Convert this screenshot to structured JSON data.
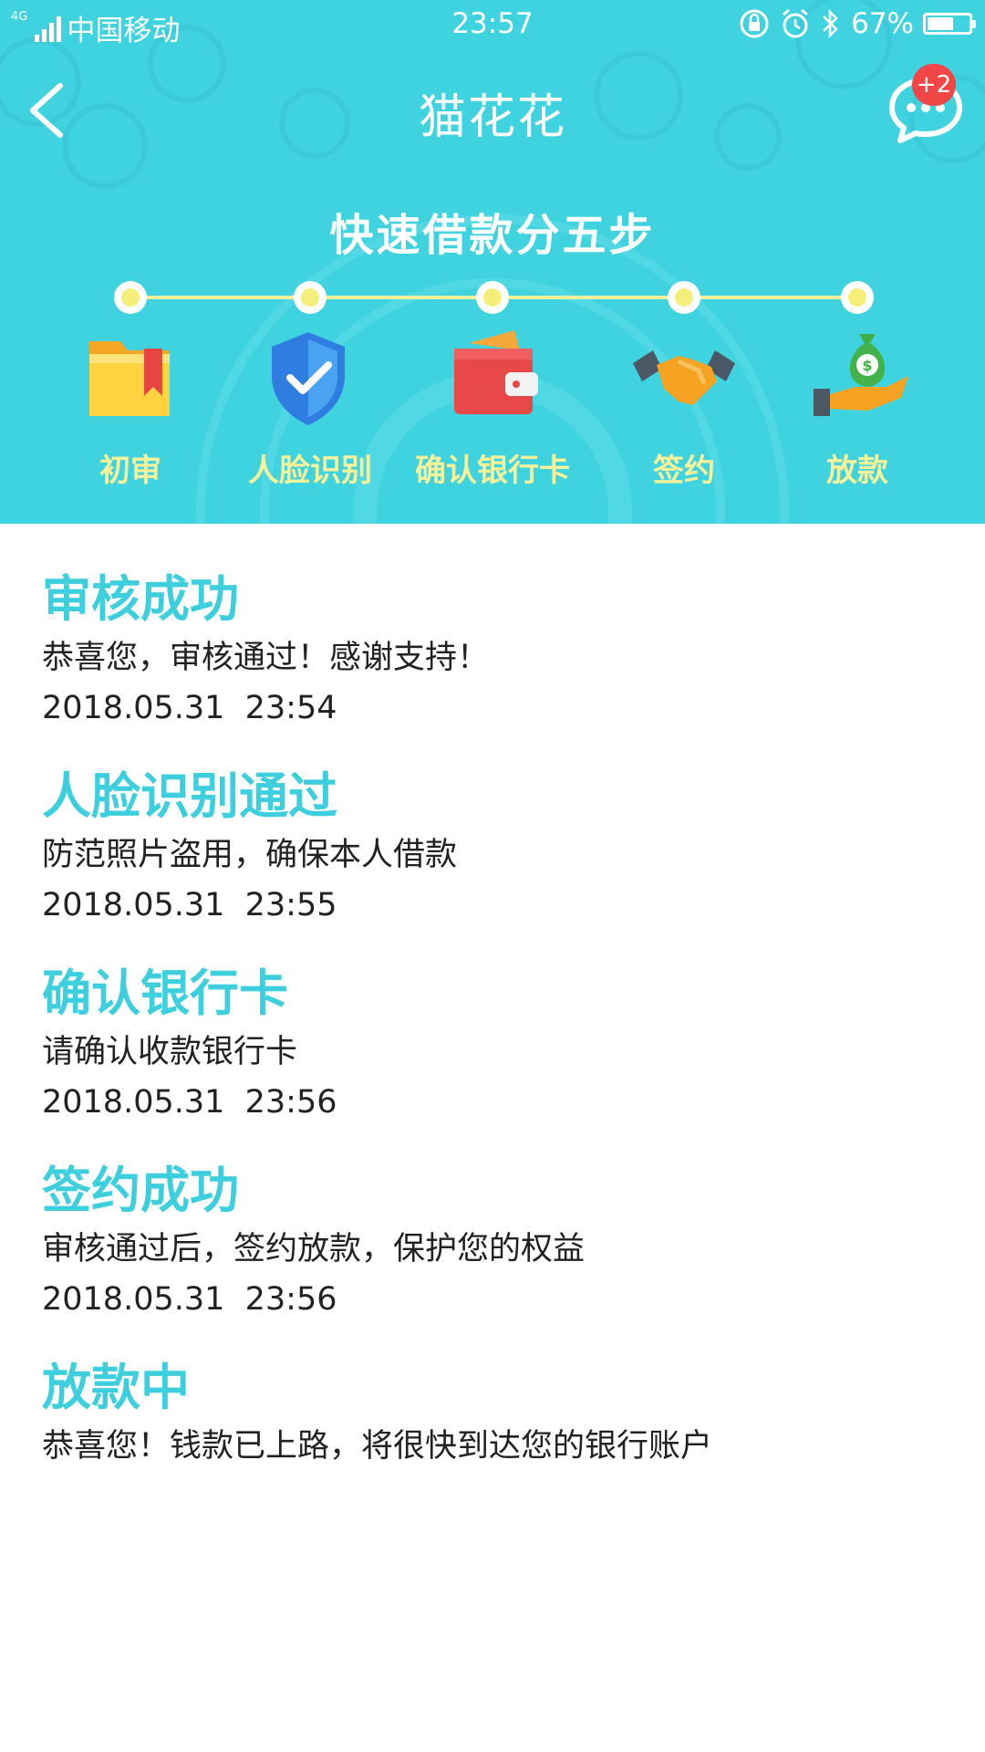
{
  "status_bar": {
    "network": "4G",
    "carrier": "中国移动",
    "time": "23:57",
    "battery_percent": "67%",
    "battery_level": 0.67
  },
  "nav": {
    "title": "猫花花",
    "badge_count": "+2"
  },
  "hero": {
    "heading": "快速借款分五步",
    "steps": [
      {
        "label": "初审",
        "icon": "folder-icon"
      },
      {
        "label": "人脸识别",
        "icon": "shield-check-icon"
      },
      {
        "label": "确认银行卡",
        "icon": "wallet-icon"
      },
      {
        "label": "签约",
        "icon": "handshake-icon"
      },
      {
        "label": "放款",
        "icon": "money-bag-icon"
      }
    ]
  },
  "timeline": [
    {
      "title": "审核成功",
      "desc": "恭喜您，审核通过！感谢支持！",
      "time": "2018.05.31  23:54"
    },
    {
      "title": "人脸识别通过",
      "desc": "防范照片盗用，确保本人借款",
      "time": "2018.05.31  23:55"
    },
    {
      "title": "确认银行卡",
      "desc": "请确认收款银行卡",
      "time": "2018.05.31  23:56"
    },
    {
      "title": "签约成功",
      "desc": "审核通过后，签约放款，保护您的权益",
      "time": "2018.05.31  23:56"
    },
    {
      "title": "放款中",
      "desc": "恭喜您！钱款已上路，将很快到达您的银行账户",
      "time": ""
    }
  ],
  "colors": {
    "hero_bg": "#3fd3e0",
    "accent": "#3ecfdf",
    "step_label": "#f7f19a",
    "badge": "#f24646"
  }
}
